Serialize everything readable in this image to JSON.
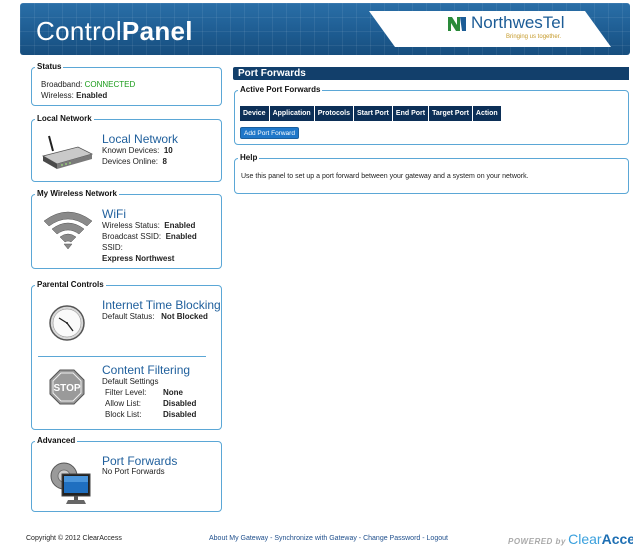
{
  "header": {
    "title_light": "Control",
    "title_bold": "Panel",
    "brand_name": "NorthwesTel",
    "brand_tagline": "Bringing us together."
  },
  "status": {
    "legend": "Status",
    "broadband_label": "Broadband:",
    "broadband_value": "CONNECTED",
    "wireless_label": "Wireless:",
    "wireless_value": "Enabled"
  },
  "local_network": {
    "legend": "Local Network",
    "title": "Local Network",
    "known_label": "Known Devices:",
    "known_value": "10",
    "online_label": "Devices Online:",
    "online_value": "8"
  },
  "wireless": {
    "legend": "My Wireless Network",
    "title": "WiFi",
    "status_label": "Wireless Status:",
    "status_value": "Enabled",
    "broadcast_label": "Broadcast SSID:",
    "broadcast_value": "Enabled",
    "ssid_label": "SSID:",
    "ssid_value": "Express Northwest"
  },
  "parental": {
    "legend": "Parental Controls",
    "itb_title": "Internet Time Blocking",
    "itb_label": "Default Status:",
    "itb_value": "Not Blocked",
    "cf_title": "Content Filtering",
    "cf_sub": "Default Settings",
    "filter_label": "Filter Level:",
    "filter_value": "None",
    "allow_label": "Allow List:",
    "allow_value": "Disabled",
    "block_label": "Block List:",
    "block_value": "Disabled",
    "stop_text": "STOP"
  },
  "advanced": {
    "legend": "Advanced",
    "title": "Port Forwards",
    "sub": "No Port Forwards"
  },
  "main": {
    "panel_title": "Port Forwards",
    "active_legend": "Active Port Forwards",
    "columns": [
      "Device",
      "Application",
      "Protocols",
      "Start Port",
      "End Port",
      "Target Port",
      "Action"
    ],
    "add_button": "Add Port Forward",
    "help_legend": "Help",
    "help_text": "Use this panel to set up a port forward between your gateway and a system on your network."
  },
  "footer": {
    "copyright": "Copyright © 2012 ClearAccess",
    "link_about": "About My Gateway",
    "link_sync": "Synchronize with Gateway",
    "link_pass": "Change Password",
    "link_logout": "Logout",
    "sep": " - ",
    "powered_by": "POWERED by",
    "powered_clear": "Clear",
    "powered_access": "Access"
  },
  "colors": {
    "header_blue": "#1d5b90",
    "panel_navy": "#123f6b",
    "border_blue": "#5ba7d6",
    "connected_green": "#1a9c1a",
    "link_blue": "#1f5f9c"
  },
  "icons": [
    "router-icon",
    "wifi-icon",
    "clock-icon",
    "stop-sign-icon",
    "computer-icon",
    "northwestel-logo-icon"
  ]
}
